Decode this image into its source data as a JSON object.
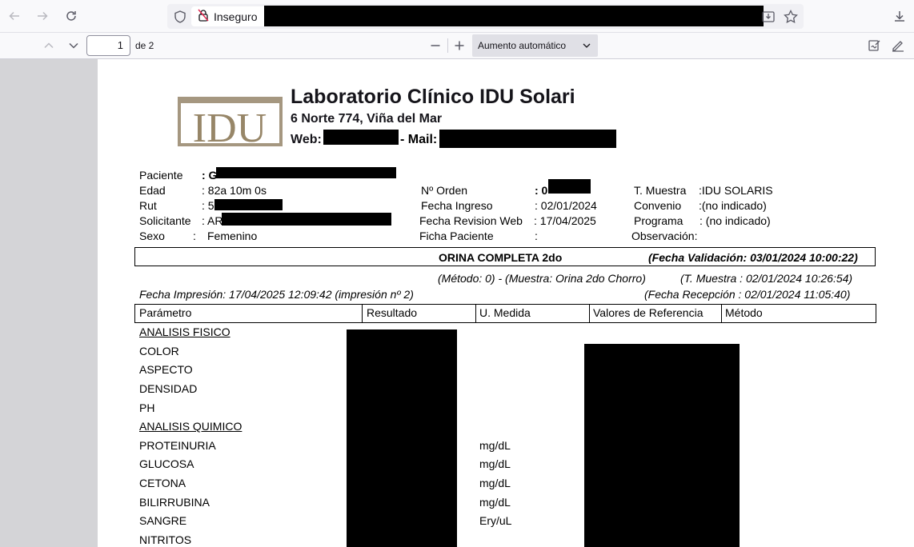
{
  "browser": {
    "insecure_label": "Inseguro"
  },
  "pdf_toolbar": {
    "page_number": "1",
    "page_of": "de 2",
    "zoom_label": "Aumento automático"
  },
  "header": {
    "logo_text": "IDU",
    "title": "Laboratorio Clínico IDU Solari",
    "address": "6 Norte 774, Viña del Mar",
    "web_label": "Web:",
    "mail_label": "- Mail:"
  },
  "patient": {
    "paciente_label": "Paciente",
    "paciente_value": ": G",
    "edad_label": "Edad",
    "edad_value": ": 82a 10m 0s",
    "rut_label": "Rut",
    "rut_value": ": 5",
    "solicitante_label": "Solicitante",
    "solicitante_value": ": AR",
    "sexo_label": "Sexo",
    "sexo_sep": ":",
    "sexo_value": "Femenino",
    "orden_label": "Nº Orden",
    "orden_value": ": 0",
    "ingreso_label": "Fecha Ingreso",
    "ingreso_value": ": 02/01/2024",
    "revision_label": "Fecha Revision Web",
    "revision_value": ": 17/04/2025",
    "ficha_label": "Ficha Paciente",
    "ficha_value": ":",
    "muestra_label": "T. Muestra",
    "muestra_value": ":IDU SOLARIS",
    "convenio_label": "Convenio",
    "convenio_value": ":(no indicado)",
    "programa_label": "Programa",
    "programa_value": ": (no indicado)",
    "observacion_label": "Observación:"
  },
  "exam": {
    "title": "ORINA COMPLETA 2do",
    "validation": "(Fecha Validación: 03/01/2024 10:00:22)",
    "method_sample": "(Método: 0) - (Muestra: Orina 2do Chorro)",
    "t_muestra": "(T. Muestra : 02/01/2024 10:26:54)",
    "print_date": "Fecha Impresión: 17/04/2025 12:09:42 (impresión nº 2)",
    "reception": "(Fecha Recepción : 02/01/2024 11:05:40)"
  },
  "table": {
    "headers": [
      "Parámetro",
      "Resultado",
      "U. Medida",
      "Valores de Referencia",
      "Método"
    ],
    "rows": [
      {
        "param": "ANALISIS FISICO",
        "unit": ""
      },
      {
        "param": "COLOR",
        "unit": ""
      },
      {
        "param": "ASPECTO",
        "unit": ""
      },
      {
        "param": "DENSIDAD",
        "unit": ""
      },
      {
        "param": "PH",
        "unit": ""
      },
      {
        "param": "ANALISIS QUIMICO",
        "unit": ""
      },
      {
        "param": "PROTEINURIA",
        "unit": "mg/dL"
      },
      {
        "param": "GLUCOSA",
        "unit": "mg/dL"
      },
      {
        "param": "CETONA",
        "unit": "mg/dL"
      },
      {
        "param": "BILIRRUBINA",
        "unit": "mg/dL"
      },
      {
        "param": "SANGRE",
        "unit": "Ery/uL"
      },
      {
        "param": "NITRITOS",
        "unit": ""
      }
    ]
  }
}
